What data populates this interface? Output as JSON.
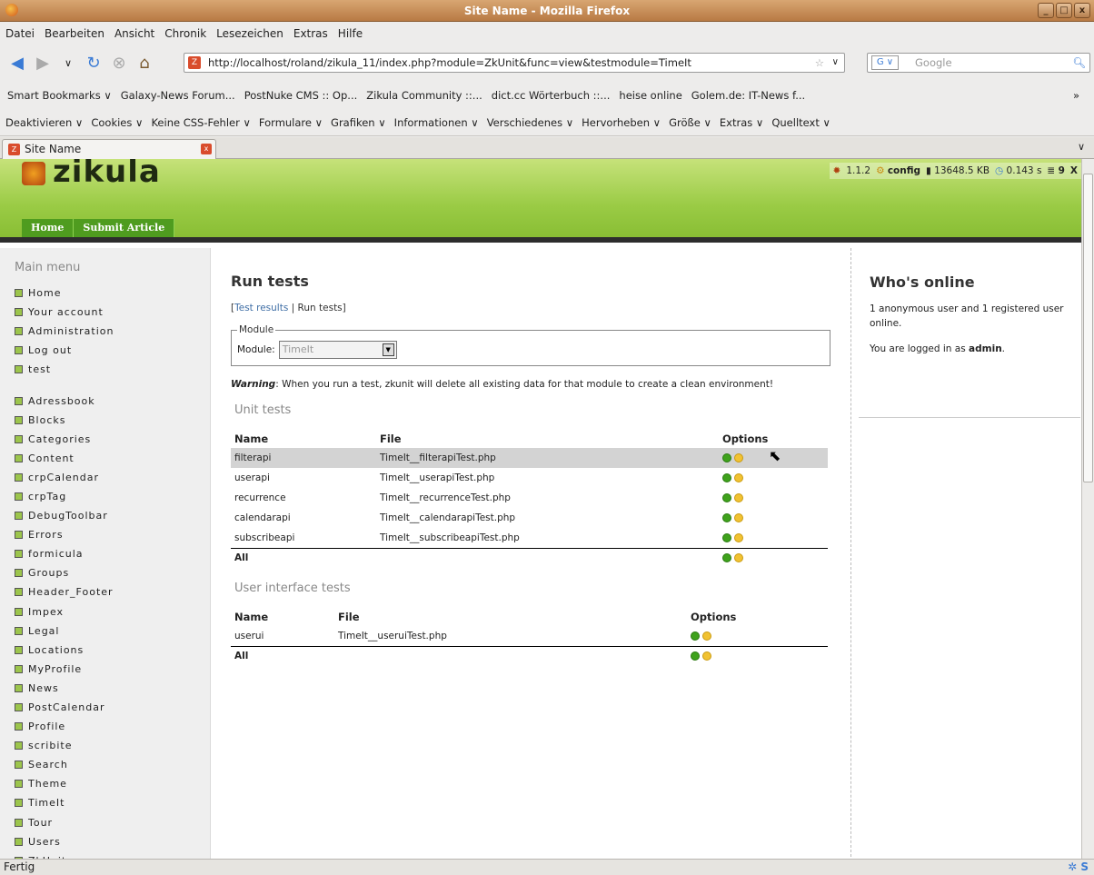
{
  "window": {
    "title": "Site Name - Mozilla Firefox",
    "buttons": [
      "_",
      "□",
      "x"
    ]
  },
  "menu": [
    "Datei",
    "Bearbeiten",
    "Ansicht",
    "Chronik",
    "Lesezeichen",
    "Extras",
    "Hilfe"
  ],
  "nav": {
    "url": "http://localhost/roland/zikula_11/index.php?module=ZkUnit&func=view&testmodule=TimeIt",
    "search_placeholder": "Google"
  },
  "bookmarks": [
    "Smart Bookmarks ∨",
    "Galaxy-News Forum...",
    "PostNuke CMS :: Op...",
    "Zikula Community ::...",
    "dict.cc Wörterbuch ::...",
    "heise online",
    "Golem.de: IT-News f...",
    "»"
  ],
  "webdev": [
    "Deaktivieren ∨",
    "Cookies ∨",
    "Keine CSS-Fehler ∨",
    "Formulare ∨",
    "Grafiken ∨",
    "Informationen ∨",
    "Verschiedenes ∨",
    "Hervorheben ∨",
    "Größe ∨",
    "Extras ∨",
    "Quelltext ∨"
  ],
  "tab": {
    "label": "Site Name"
  },
  "site": {
    "logo": "zikula",
    "navtabs": [
      "Home",
      "Submit Article"
    ],
    "debug": {
      "version": "1.1.2",
      "config": "config",
      "memory": "13648.5 KB",
      "time": "0.143 s",
      "queries": "9",
      "close": "X"
    }
  },
  "sidebar": {
    "title": "Main menu",
    "group1": [
      "Home",
      "Your account",
      "Administration",
      "Log out",
      "test"
    ],
    "group2": [
      "Adressbook",
      "Blocks",
      "Categories",
      "Content",
      "crpCalendar",
      "crpTag",
      "DebugToolbar",
      "Errors",
      "formicula",
      "Groups",
      "Header_Footer",
      "Impex",
      "Legal",
      "Locations",
      "MyProfile",
      "News",
      "PostCalendar",
      "Profile",
      "scribite",
      "Search",
      "Theme",
      "TimeIt",
      "Tour",
      "Users",
      "ZkUnit"
    ]
  },
  "main": {
    "title": "Run tests",
    "link_results": "Test results",
    "link_sep": "|",
    "link_run": "Run tests",
    "bracket_open": "[",
    "bracket_close": "]",
    "fieldset_legend": "Module",
    "module_label": "Module:",
    "module_value": "TimeIt",
    "warning_label": "Warning",
    "warning_text": ": When you run a test, zkunit will delete all existing data for that module to create a clean environment!",
    "unit_title": "Unit tests",
    "unit_headers": [
      "Name",
      "File",
      "Options"
    ],
    "unit_rows": [
      {
        "name": "filterapi",
        "file": "TimeIt__filterapiTest.php"
      },
      {
        "name": "userapi",
        "file": "TimeIt__userapiTest.php"
      },
      {
        "name": "recurrence",
        "file": "TimeIt__recurrenceTest.php"
      },
      {
        "name": "calendarapi",
        "file": "TimeIt__calendarapiTest.php"
      },
      {
        "name": "subscribeapi",
        "file": "TimeIt__subscribeapiTest.php"
      }
    ],
    "all_label": "All",
    "ui_title": "User interface tests",
    "ui_headers": [
      "Name",
      "File",
      "Options"
    ],
    "ui_rows": [
      {
        "name": "userui",
        "file": "TimeIt__useruiTest.php"
      }
    ]
  },
  "online": {
    "title": "Who's online",
    "line1": "1 anonymous user and 1 registered user online.",
    "line2_prefix": "You are logged in as ",
    "line2_user": "admin",
    "line2_suffix": "."
  },
  "status": {
    "text": "Fertig"
  }
}
